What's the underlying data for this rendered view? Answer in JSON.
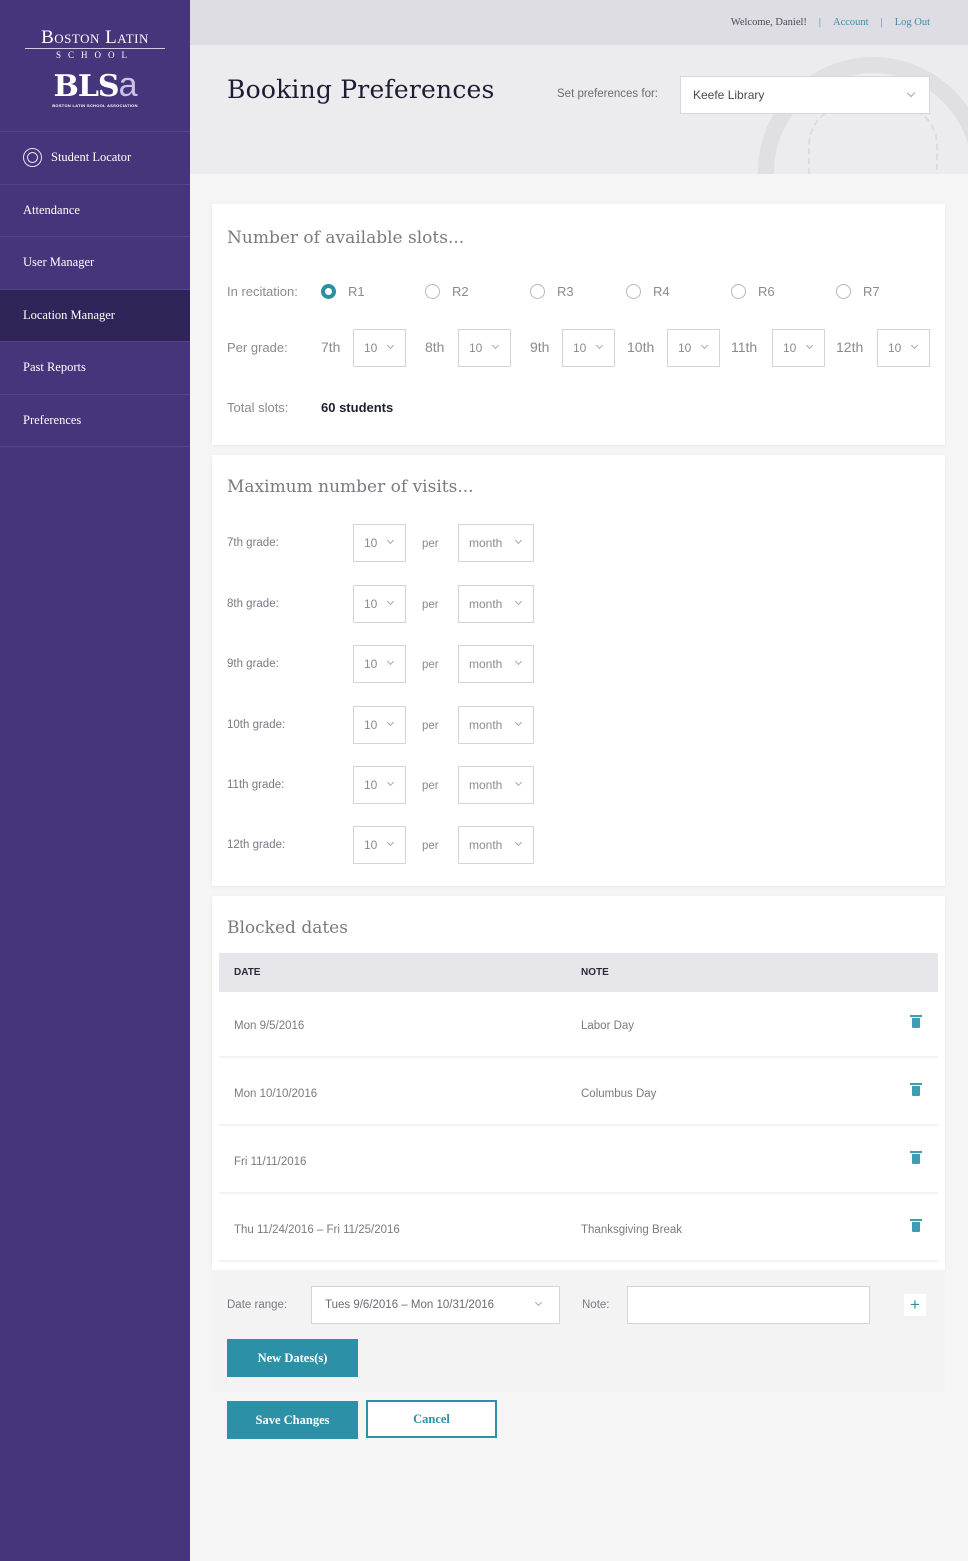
{
  "brand": {
    "line1": "Boston Latin",
    "line2": "SCHOOL",
    "mark_prefix": "BLS",
    "mark_suffix": "a",
    "tagline": "BOSTON LATIN SCHOOL ASSOCIATION"
  },
  "sidebar": {
    "items": [
      {
        "label": "Student Locator",
        "icon": "compass-icon",
        "active": false
      },
      {
        "label": "Attendance",
        "active": false
      },
      {
        "label": "User Manager",
        "active": false
      },
      {
        "label": "Location Manager",
        "active": true
      },
      {
        "label": "Past Reports",
        "active": false
      },
      {
        "label": "Preferences",
        "active": false
      }
    ]
  },
  "topbar": {
    "welcome": "Welcome, Daniel!",
    "separator": "|",
    "account": "Account",
    "logout": "Log Out"
  },
  "header": {
    "title": "Booking Preferences",
    "set_for_label": "Set preferences for:",
    "location_selected": "Keefe Library"
  },
  "slots": {
    "title": "Number of available slots...",
    "recitation_label": "In recitation:",
    "recitations": [
      {
        "label": "R1",
        "checked": true
      },
      {
        "label": "R2",
        "checked": false
      },
      {
        "label": "R3",
        "checked": false
      },
      {
        "label": "R4",
        "checked": false
      },
      {
        "label": "R6",
        "checked": false
      },
      {
        "label": "R7",
        "checked": false
      }
    ],
    "per_grade_label": "Per grade:",
    "grades": [
      {
        "grade": "7th",
        "value": "10"
      },
      {
        "grade": "8th",
        "value": "10"
      },
      {
        "grade": "9th",
        "value": "10"
      },
      {
        "grade": "10th",
        "value": "10"
      },
      {
        "grade": "11th",
        "value": "10"
      },
      {
        "grade": "12th",
        "value": "10"
      }
    ],
    "total_label": "Total slots:",
    "total_value": "60 students"
  },
  "visits": {
    "title": "Maximum number of visits...",
    "per_label": "per",
    "rows": [
      {
        "label": "7th grade:",
        "count": "10",
        "period": "month"
      },
      {
        "label": "8th grade:",
        "count": "10",
        "period": "month"
      },
      {
        "label": "9th grade:",
        "count": "10",
        "period": "month"
      },
      {
        "label": "10th grade:",
        "count": "10",
        "period": "month"
      },
      {
        "label": "11th grade:",
        "count": "10",
        "period": "month"
      },
      {
        "label": "12th grade:",
        "count": "10",
        "period": "month"
      }
    ]
  },
  "blocked": {
    "title": "Blocked dates",
    "columns": [
      "DATE",
      "NOTE"
    ],
    "rows": [
      {
        "date": "Mon 9/5/2016",
        "note": "Labor Day"
      },
      {
        "date": "Mon 10/10/2016",
        "note": "Columbus Day"
      },
      {
        "date": "Fri 11/11/2016",
        "note": ""
      },
      {
        "date": "Thu 11/24/2016 – Fri 11/25/2016",
        "note": "Thanksgiving Break"
      }
    ],
    "date_range_label": "Date range:",
    "date_range_value": "Tues 9/6/2016 – Mon 10/31/2016",
    "note_label": "Note:",
    "note_value": "",
    "add_symbol": "+",
    "new_dates_button": "New Dates(s)"
  },
  "actions": {
    "save": "Save Changes",
    "cancel": "Cancel"
  },
  "colors": {
    "sidebar": "#46357a",
    "sidebar_active": "#302358",
    "accent": "#2c91a6"
  }
}
